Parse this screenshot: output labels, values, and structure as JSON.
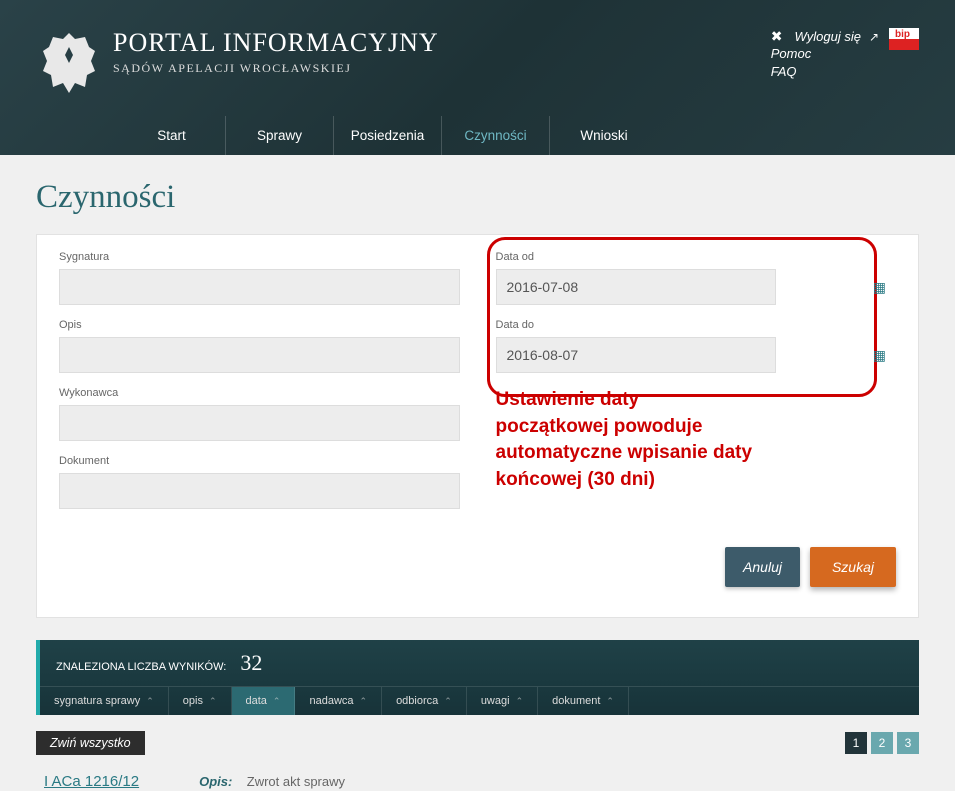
{
  "header": {
    "title": "PORTAL INFORMACYJNY",
    "subtitle": "SĄDÓW APELACJI WROCŁAWSKIEJ",
    "logout": "Wyloguj się",
    "help": "Pomoc",
    "faq": "FAQ",
    "bip": "bip"
  },
  "nav": {
    "start": "Start",
    "sprawy": "Sprawy",
    "posiedzenia": "Posiedzenia",
    "czynnosci": "Czynności",
    "wnioski": "Wnioski"
  },
  "page": {
    "title": "Czynności"
  },
  "form": {
    "sygnatura_label": "Sygnatura",
    "opis_label": "Opis",
    "wykonawca_label": "Wykonawca",
    "dokument_label": "Dokument",
    "data_od_label": "Data od",
    "data_od_value": "2016-07-08",
    "data_do_label": "Data do",
    "data_do_value": "2016-08-07",
    "cancel": "Anuluj",
    "search": "Szukaj",
    "annotation": "Ustawienie daty początkowej powoduje automatyczne wpisanie daty końcowej (30 dni)"
  },
  "results": {
    "label": "ZNALEZIONA LICZBA WYNIKÓW:",
    "count": "32",
    "sort": {
      "sygnatura": "sygnatura sprawy",
      "opis": "opis",
      "data": "data",
      "nadawca": "nadawca",
      "odbiorca": "odbiorca",
      "uwagi": "uwagi",
      "dokument": "dokument"
    },
    "collapse": "Zwiń wszystko",
    "pages": {
      "p1": "1",
      "p2": "2",
      "p3": "3"
    },
    "first": {
      "case": "I ACa 1216/12",
      "opis_label": "Opis:",
      "opis_value": "Zwrot akt sprawy"
    }
  }
}
